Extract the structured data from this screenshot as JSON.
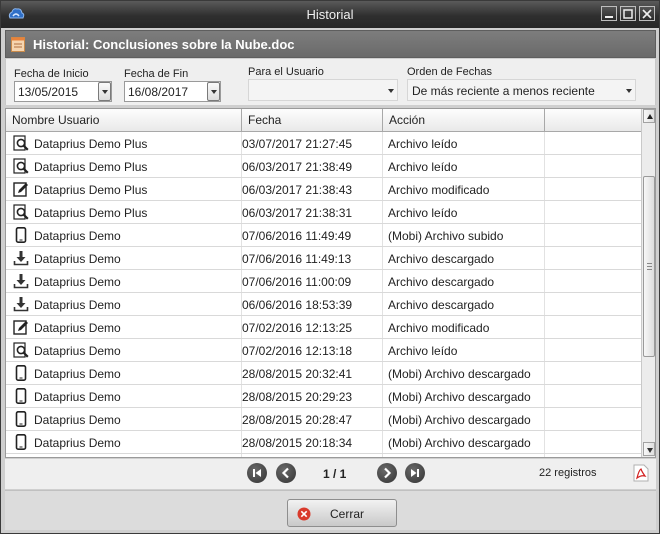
{
  "window": {
    "title": "Historial"
  },
  "header": {
    "title": "Historial: Conclusiones sobre la Nube.doc"
  },
  "filters": {
    "start_label": "Fecha de Inicio",
    "start_value": "13/05/2015",
    "end_label": "Fecha de Fin",
    "end_value": "16/08/2017",
    "user_label": "Para el Usuario",
    "user_value": "",
    "order_label": "Orden de Fechas",
    "order_value": "De más reciente a menos reciente"
  },
  "table": {
    "columns": [
      "Nombre Usuario",
      "Fecha",
      "Acción"
    ],
    "rows": [
      {
        "icon": "view-icon",
        "user": "Dataprius Demo Plus",
        "fecha": "03/07/2017 21:27:45",
        "accion": "Archivo leído"
      },
      {
        "icon": "view-icon",
        "user": "Dataprius Demo Plus",
        "fecha": "06/03/2017 21:38:49",
        "accion": "Archivo leído"
      },
      {
        "icon": "edit-icon",
        "user": "Dataprius Demo Plus",
        "fecha": "06/03/2017 21:38:43",
        "accion": "Archivo modificado"
      },
      {
        "icon": "view-icon",
        "user": "Dataprius Demo Plus",
        "fecha": "06/03/2017 21:38:31",
        "accion": "Archivo leído"
      },
      {
        "icon": "mobile-icon",
        "user": "Dataprius Demo",
        "fecha": "07/06/2016 11:49:49",
        "accion": "(Mobi) Archivo subido"
      },
      {
        "icon": "download-icon",
        "user": "Dataprius Demo",
        "fecha": "07/06/2016 11:49:13",
        "accion": "Archivo descargado"
      },
      {
        "icon": "download-icon",
        "user": "Dataprius Demo",
        "fecha": "07/06/2016 11:00:09",
        "accion": "Archivo descargado"
      },
      {
        "icon": "download-icon",
        "user": "Dataprius Demo",
        "fecha": "06/06/2016 18:53:39",
        "accion": "Archivo descargado"
      },
      {
        "icon": "edit-icon",
        "user": "Dataprius Demo",
        "fecha": "07/02/2016 12:13:25",
        "accion": "Archivo modificado"
      },
      {
        "icon": "view-icon",
        "user": "Dataprius Demo",
        "fecha": "07/02/2016 12:13:18",
        "accion": "Archivo leído"
      },
      {
        "icon": "mobile-icon",
        "user": "Dataprius Demo",
        "fecha": "28/08/2015 20:32:41",
        "accion": "(Mobi) Archivo descargado"
      },
      {
        "icon": "mobile-icon",
        "user": "Dataprius Demo",
        "fecha": "28/08/2015 20:29:23",
        "accion": "(Mobi) Archivo descargado"
      },
      {
        "icon": "mobile-icon",
        "user": "Dataprius Demo",
        "fecha": "28/08/2015 20:28:47",
        "accion": "(Mobi) Archivo descargado"
      },
      {
        "icon": "mobile-icon",
        "user": "Dataprius Demo",
        "fecha": "28/08/2015 20:18:34",
        "accion": "(Mobi) Archivo descargado"
      }
    ]
  },
  "pager": {
    "page_info": "1 / 1",
    "count": "22 registros"
  },
  "footer": {
    "close_label": "Cerrar"
  }
}
